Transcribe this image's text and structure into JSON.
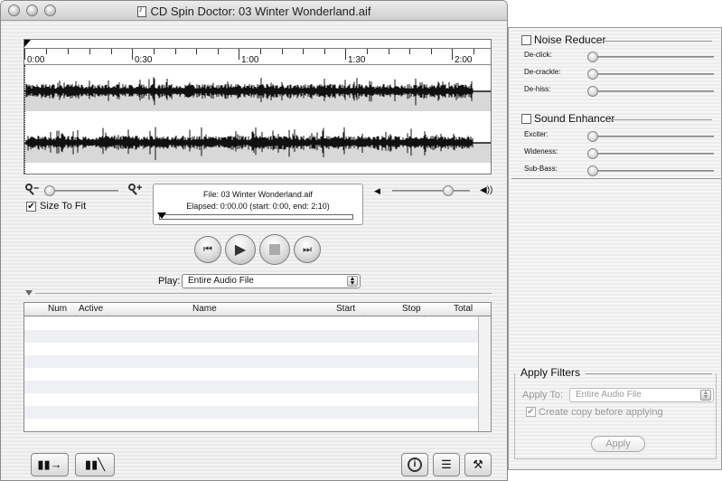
{
  "window": {
    "title": "CD Spin Doctor: 03 Winter Wonderland.aif"
  },
  "waveform": {
    "time_labels": [
      "0:00",
      "0:30",
      "1:00",
      "1:30",
      "2:00"
    ]
  },
  "zoom": {
    "size_to_fit_label": "Size To Fit",
    "size_to_fit_checked": true
  },
  "info": {
    "file_line": "File: 03 Winter Wonderland.aif",
    "elapsed_line": "Elapsed: 0:00.00 (start: 0:00, end: 2:10)"
  },
  "volume": {
    "level": 0.78
  },
  "transport": {
    "play_label": "Play:",
    "play_value": "Entire Audio File"
  },
  "table": {
    "columns": [
      "Num",
      "Active",
      "Name",
      "Start",
      "Stop",
      "Total"
    ],
    "rows": []
  },
  "filters": {
    "noise_reducer": {
      "title": "Noise Reducer",
      "enabled": false,
      "controls": [
        "De-click:",
        "De-crackle:",
        "De-hiss:"
      ]
    },
    "sound_enhancer": {
      "title": "Sound Enhancer",
      "enabled": false,
      "controls": [
        "Exciter:",
        "Wideness:",
        "Sub-Bass:"
      ]
    },
    "apply_filters": {
      "title": "Apply Filters",
      "apply_to_label": "Apply To:",
      "apply_to_value": "Entire Audio File",
      "copy_label": "Create copy before applying",
      "copy_checked": true,
      "apply_button": "Apply"
    }
  }
}
